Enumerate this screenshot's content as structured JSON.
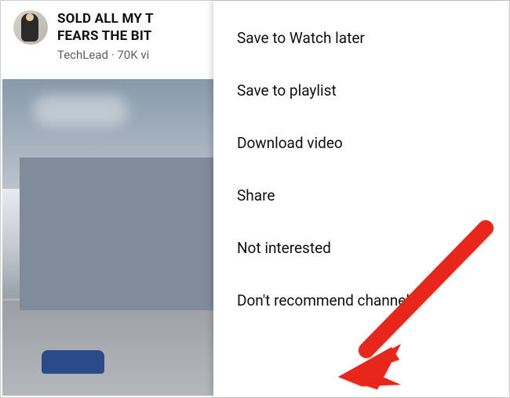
{
  "header": {
    "title": "SOLD ALL MY T\nFEARS THE BIT",
    "channel": "TechLead",
    "views_fragment": "70K vi"
  },
  "menu": {
    "items": [
      "Save to Watch later",
      "Save to playlist",
      "Download video",
      "Share",
      "Not interested",
      "Don't recommend channel"
    ]
  }
}
